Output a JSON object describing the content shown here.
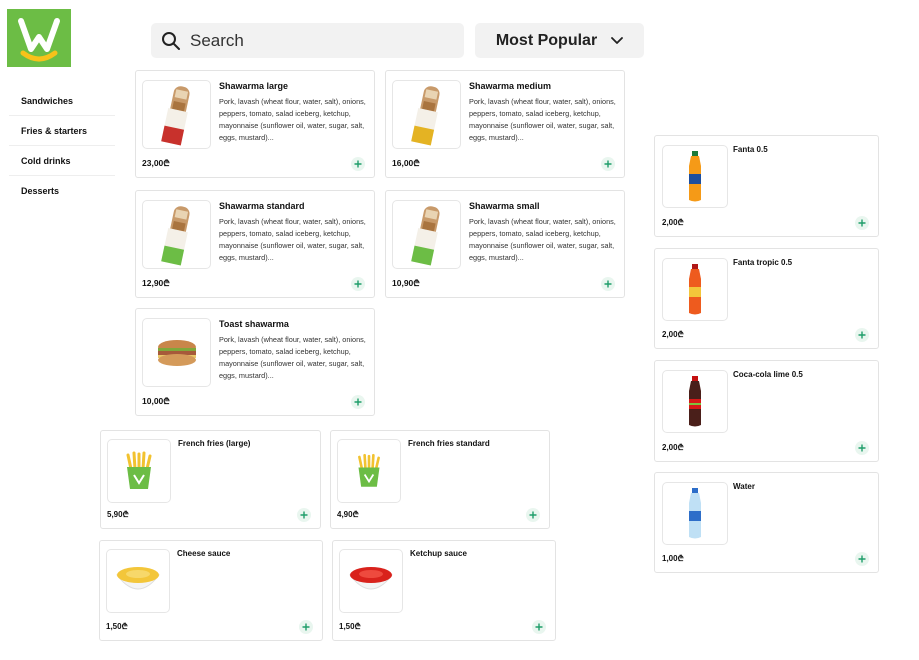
{
  "logo": {
    "alt": "brand logo",
    "colors": {
      "bg": "#6cbd45",
      "mark": "#ffffff",
      "accent": "#f7c21a"
    }
  },
  "search": {
    "placeholder": "Search",
    "icon": "search-icon"
  },
  "sort": {
    "selected": "Most Popular",
    "icon": "chevron-down-icon"
  },
  "categories": [
    {
      "label": "Sandwiches"
    },
    {
      "label": "Fries & starters"
    },
    {
      "label": "Cold drinks"
    },
    {
      "label": "Desserts"
    }
  ],
  "shawarma_desc": "Pork, lavash (wheat flour, water, salt), onions, peppers, tomato, salad iceberg, ketchup, mayonnaise (sunflower oil, water, sugar, salt, eggs, mustard)...",
  "sandwiches": [
    {
      "name": "Shawarma large",
      "price": "23,00₾",
      "wrap_color": "#c8312c"
    },
    {
      "name": "Shawarma medium",
      "price": "16,00₾",
      "wrap_color": "#e4b323"
    },
    {
      "name": "Shawarma standard",
      "price": "12,90₾",
      "wrap_color": "#6cbd45"
    },
    {
      "name": "Shawarma small",
      "price": "10,90₾",
      "wrap_color": "#6cbd45"
    },
    {
      "name": "Toast shawarma",
      "price": "10,00₾"
    }
  ],
  "starters": [
    {
      "name": "French fries (large)",
      "price": "5,90₾"
    },
    {
      "name": "French fries standard",
      "price": "4,90₾"
    },
    {
      "name": "Cheese sauce",
      "price": "1,50₾",
      "sauce_color": "#f3c63a"
    },
    {
      "name": "Ketchup sauce",
      "price": "1,50₾",
      "sauce_color": "#d9221c"
    }
  ],
  "drinks": [
    {
      "name": "Fanta 0.5",
      "price": "2,00₾",
      "bottle_color": "#f59a17"
    },
    {
      "name": "Fanta tropic 0.5",
      "price": "2,00₾",
      "bottle_color": "#ee5b1e"
    },
    {
      "name": "Coca-cola lime 0.5",
      "price": "2,00₾",
      "bottle_color": "#4a1f1a"
    },
    {
      "name": "Water",
      "price": "1,00₾",
      "bottle_color": "#bfe0f5"
    }
  ],
  "accent_color": "#1f9d6a"
}
